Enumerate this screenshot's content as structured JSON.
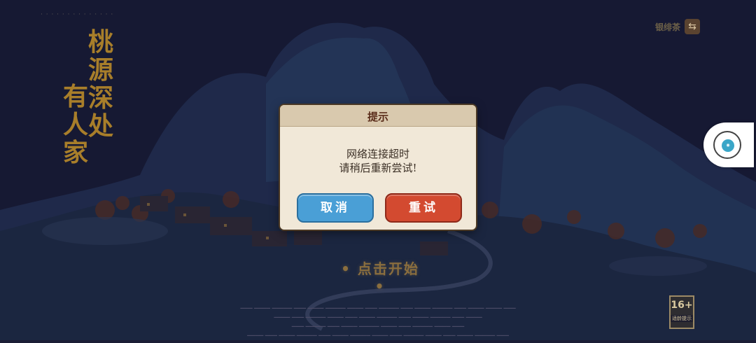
{
  "title_art": [
    "桃",
    "源",
    "深",
    "处",
    "有",
    "人",
    "家"
  ],
  "account": {
    "name": "银绯茶",
    "switch_icon": "switch-arrows-icon"
  },
  "start_label": "• 点击开始 •",
  "dialog": {
    "title": "提示",
    "message_line1": "网络连接超时",
    "message_line2": "请稍后重新尝试!",
    "cancel_label": "取消",
    "retry_label": "重试"
  },
  "age_rating": {
    "number": "16+",
    "label": "适龄提示"
  },
  "colors": {
    "background": "#1b1d35",
    "dialog_bg": "#f1e8d8",
    "cancel_button": "#4a9fd6",
    "retry_button": "#d34a30",
    "title_gold": "#b88a2a"
  }
}
